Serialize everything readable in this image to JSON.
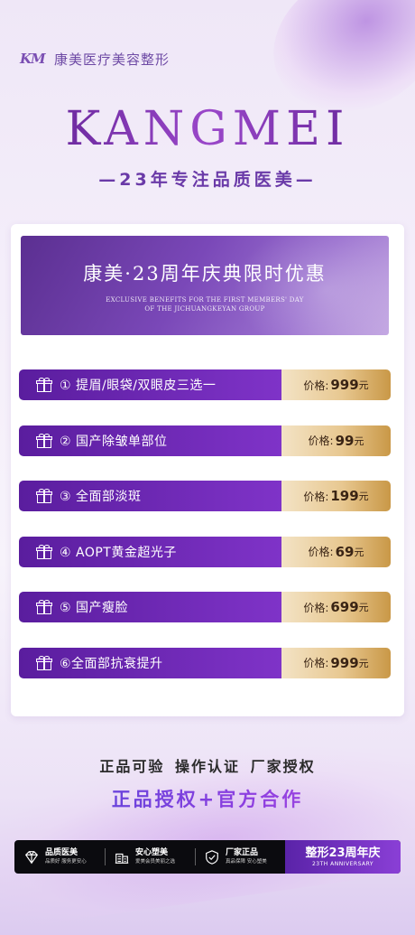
{
  "brand": {
    "logo_mark": "KM",
    "logo_text": "康美医疗美容整形",
    "title": "KANGMEI",
    "tagline": "—23年专注品质医美—"
  },
  "promo": {
    "title": "康美·23周年庆典限时优惠",
    "subtitle_line1": "EXCLUSIVE BENEFITS FOR THE FIRST MEMBERS' DAY",
    "subtitle_line2": "OF THE JICHUANGKEYAN GROUP"
  },
  "price_label": "价格:",
  "currency_unit": "元",
  "items": [
    {
      "name": "① 提眉/眼袋/双眼皮三选一",
      "price": "999"
    },
    {
      "name": "② 国产除皱单部位",
      "price": "99"
    },
    {
      "name": "③ 全面部淡斑",
      "price": "199"
    },
    {
      "name": "④ AOPT黄金超光子",
      "price": "69"
    },
    {
      "name": "⑤ 国产瘦脸",
      "price": "699"
    },
    {
      "name": "⑥全面部抗衰提升",
      "price": "999"
    }
  ],
  "features_line": "正品可验 操作认证 厂家授权",
  "slogan": "正品授权+官方合作",
  "bottom_bar": {
    "segments": [
      {
        "icon": "diamond-icon",
        "title": "品质医美",
        "sub": "品质好 服务更安心"
      },
      {
        "icon": "building-icon",
        "title": "安心塑美",
        "sub": "爱美会员美丽之选"
      },
      {
        "icon": "shield-check-icon",
        "title": "厂家正品",
        "sub": "真品保障 安心塑美"
      }
    ],
    "anniversary_title": "整形23周年庆",
    "anniversary_sub": "23TH ANNIVERSARY"
  }
}
